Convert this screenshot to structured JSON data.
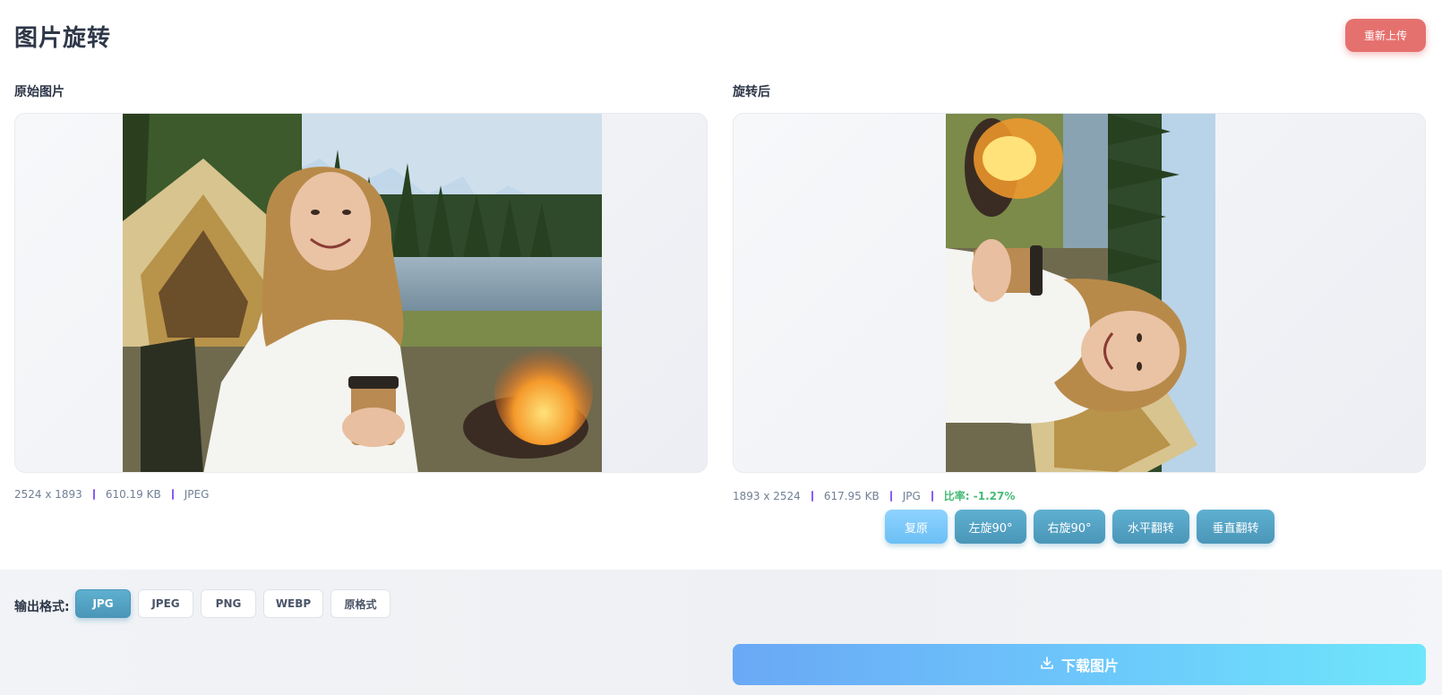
{
  "header": {
    "title": "图片旋转",
    "reupload_label": "重新上传"
  },
  "original": {
    "label": "原始图片",
    "dimensions": "2524 x 1893",
    "size": "610.19 KB",
    "format": "JPEG"
  },
  "rotated": {
    "label": "旋转后",
    "dimensions": "1893 x 2524",
    "size": "617.95 KB",
    "format": "JPG",
    "ratio": "比率: -1.27%"
  },
  "actions": {
    "reset": "复原",
    "rotate_left": "左旋90°",
    "rotate_right": "右旋90°",
    "flip_h": "水平翻转",
    "flip_v": "垂直翻转"
  },
  "output": {
    "label": "输出格式:",
    "formats": [
      "JPG",
      "JPEG",
      "PNG",
      "WEBP",
      "原格式"
    ],
    "selected": "JPG"
  },
  "download_label": "下载图片",
  "colors": {
    "accent": "#4a96b8",
    "danger": "#e5716f",
    "ratio": "#48bb78",
    "separator": "#8b5cf6"
  }
}
